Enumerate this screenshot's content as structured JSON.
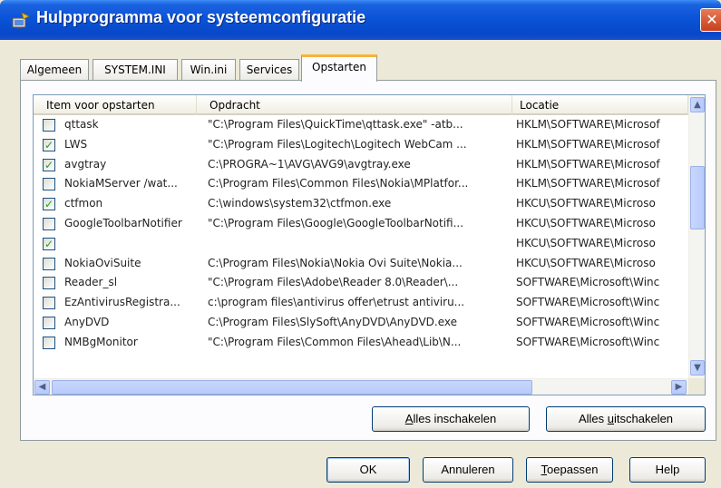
{
  "window": {
    "title": "Hulpprogramma voor systeemconfiguratie",
    "close_glyph": "✕",
    "app_icon": "msconfig-icon"
  },
  "tabs": [
    {
      "label": "Algemeen",
      "active": false
    },
    {
      "label": "SYSTEM.INI",
      "active": false
    },
    {
      "label": "Win.ini",
      "active": false
    },
    {
      "label": "Services",
      "active": false
    },
    {
      "label": "Opstarten",
      "active": true
    }
  ],
  "list": {
    "columns": [
      "Item voor opstarten",
      "Opdracht",
      "Locatie"
    ],
    "rows": [
      {
        "checked": false,
        "item": "qttask",
        "command": "\"C:\\Program Files\\QuickTime\\qttask.exe\" -atb...",
        "location": "HKLM\\SOFTWARE\\Microsof"
      },
      {
        "checked": true,
        "item": "LWS",
        "command": "\"C:\\Program Files\\Logitech\\Logitech WebCam ...",
        "location": "HKLM\\SOFTWARE\\Microsof"
      },
      {
        "checked": true,
        "item": "avgtray",
        "command": "C:\\PROGRA~1\\AVG\\AVG9\\avgtray.exe",
        "location": "HKLM\\SOFTWARE\\Microsof"
      },
      {
        "checked": false,
        "item": "NokiaMServer /wat...",
        "command": "C:\\Program Files\\Common Files\\Nokia\\MPlatfor...",
        "location": "HKLM\\SOFTWARE\\Microsof"
      },
      {
        "checked": true,
        "item": "ctfmon",
        "command": "C:\\windows\\system32\\ctfmon.exe",
        "location": "HKCU\\SOFTWARE\\Microso"
      },
      {
        "checked": false,
        "item": "GoogleToolbarNotifier",
        "command": "\"C:\\Program Files\\Google\\GoogleToolbarNotifi...",
        "location": "HKCU\\SOFTWARE\\Microso"
      },
      {
        "checked": true,
        "item": "",
        "command": "",
        "location": "HKCU\\SOFTWARE\\Microso"
      },
      {
        "checked": false,
        "item": "NokiaOviSuite",
        "command": "C:\\Program Files\\Nokia\\Nokia Ovi Suite\\Nokia...",
        "location": "HKCU\\SOFTWARE\\Microso"
      },
      {
        "checked": false,
        "item": "Reader_sl",
        "command": "\"C:\\Program Files\\Adobe\\Reader 8.0\\Reader\\...",
        "location": "SOFTWARE\\Microsoft\\Winc"
      },
      {
        "checked": false,
        "item": "EzAntivirusRegistra...",
        "command": "c:\\program files\\antivirus offer\\etrust antiviru...",
        "location": "SOFTWARE\\Microsoft\\Winc"
      },
      {
        "checked": false,
        "item": "AnyDVD",
        "command": "C:\\Program Files\\SlySoft\\AnyDVD\\AnyDVD.exe",
        "location": "SOFTWARE\\Microsoft\\Winc"
      },
      {
        "checked": false,
        "item": "NMBgMonitor",
        "command": "\"C:\\Program Files\\Common Files\\Ahead\\Lib\\N...",
        "location": "SOFTWARE\\Microsoft\\Winc"
      }
    ]
  },
  "buttons": {
    "enable_all": {
      "pre": "",
      "key": "A",
      "post": "lles inschakelen"
    },
    "disable_all": {
      "pre": "Alles ",
      "key": "u",
      "post": "itschakelen"
    },
    "ok": "OK",
    "cancel": "Annuleren",
    "apply": {
      "pre": "",
      "key": "T",
      "post": "oepassen"
    },
    "help": "Help"
  },
  "colors": {
    "titlebar": "#0a52d6",
    "active_tab_highlight": "#f8b33a",
    "checkmark": "#21a121"
  }
}
